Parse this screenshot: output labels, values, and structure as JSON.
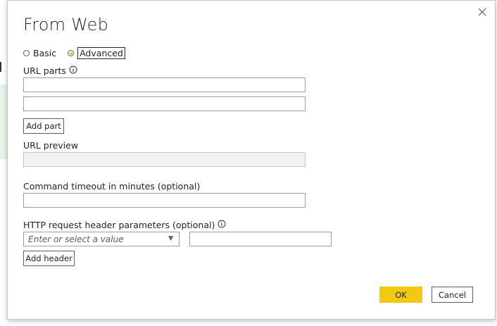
{
  "dialog": {
    "title": "From Web",
    "mode": {
      "basic_label": "Basic",
      "advanced_label": "Advanced",
      "selected": "Advanced"
    },
    "url_parts": {
      "label": "URL parts",
      "values": [
        "",
        ""
      ],
      "add_part_label": "Add part"
    },
    "url_preview": {
      "label": "URL preview",
      "value": ""
    },
    "timeout": {
      "label": "Command timeout in minutes (optional)",
      "value": ""
    },
    "headers": {
      "label": "HTTP request header parameters (optional)",
      "key_placeholder": "Enter or select a value",
      "value": "",
      "add_header_label": "Add header"
    },
    "ok_label": "OK",
    "cancel_label": "Cancel"
  },
  "icons": {
    "close": "close-icon",
    "info": "info-icon",
    "dropdown": "chevron-down-icon"
  },
  "colors": {
    "accent": "#f2c811",
    "border": "#a19f9d",
    "disabled_bg": "#f3f2f1"
  }
}
